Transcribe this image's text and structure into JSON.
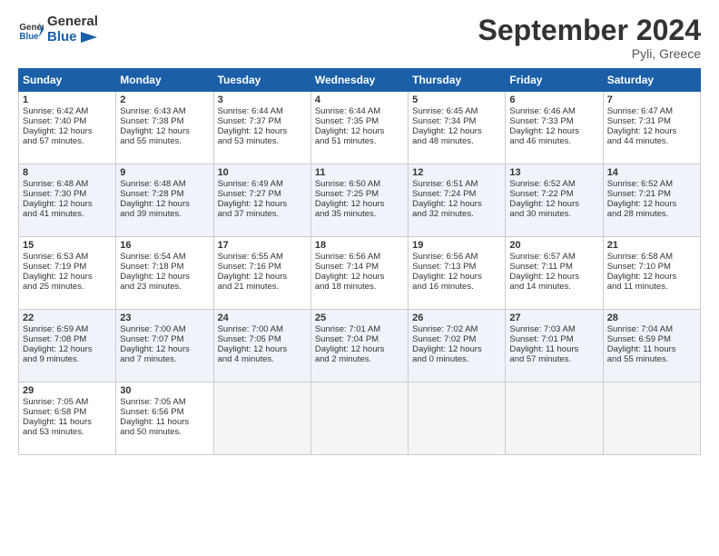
{
  "header": {
    "logo_line1": "General",
    "logo_line2": "Blue",
    "month": "September 2024",
    "location": "Pyli, Greece"
  },
  "weekdays": [
    "Sunday",
    "Monday",
    "Tuesday",
    "Wednesday",
    "Thursday",
    "Friday",
    "Saturday"
  ],
  "weeks": [
    [
      {
        "day": "1",
        "sunrise": "6:42 AM",
        "sunset": "7:40 PM",
        "daylight": "12 hours and 57 minutes."
      },
      {
        "day": "2",
        "sunrise": "6:43 AM",
        "sunset": "7:38 PM",
        "daylight": "12 hours and 55 minutes."
      },
      {
        "day": "3",
        "sunrise": "6:44 AM",
        "sunset": "7:37 PM",
        "daylight": "12 hours and 53 minutes."
      },
      {
        "day": "4",
        "sunrise": "6:44 AM",
        "sunset": "7:35 PM",
        "daylight": "12 hours and 51 minutes."
      },
      {
        "day": "5",
        "sunrise": "6:45 AM",
        "sunset": "7:34 PM",
        "daylight": "12 hours and 48 minutes."
      },
      {
        "day": "6",
        "sunrise": "6:46 AM",
        "sunset": "7:33 PM",
        "daylight": "12 hours and 46 minutes."
      },
      {
        "day": "7",
        "sunrise": "6:47 AM",
        "sunset": "7:31 PM",
        "daylight": "12 hours and 44 minutes."
      }
    ],
    [
      {
        "day": "8",
        "sunrise": "6:48 AM",
        "sunset": "7:30 PM",
        "daylight": "12 hours and 41 minutes."
      },
      {
        "day": "9",
        "sunrise": "6:48 AM",
        "sunset": "7:28 PM",
        "daylight": "12 hours and 39 minutes."
      },
      {
        "day": "10",
        "sunrise": "6:49 AM",
        "sunset": "7:27 PM",
        "daylight": "12 hours and 37 minutes."
      },
      {
        "day": "11",
        "sunrise": "6:50 AM",
        "sunset": "7:25 PM",
        "daylight": "12 hours and 35 minutes."
      },
      {
        "day": "12",
        "sunrise": "6:51 AM",
        "sunset": "7:24 PM",
        "daylight": "12 hours and 32 minutes."
      },
      {
        "day": "13",
        "sunrise": "6:52 AM",
        "sunset": "7:22 PM",
        "daylight": "12 hours and 30 minutes."
      },
      {
        "day": "14",
        "sunrise": "6:52 AM",
        "sunset": "7:21 PM",
        "daylight": "12 hours and 28 minutes."
      }
    ],
    [
      {
        "day": "15",
        "sunrise": "6:53 AM",
        "sunset": "7:19 PM",
        "daylight": "12 hours and 25 minutes."
      },
      {
        "day": "16",
        "sunrise": "6:54 AM",
        "sunset": "7:18 PM",
        "daylight": "12 hours and 23 minutes."
      },
      {
        "day": "17",
        "sunrise": "6:55 AM",
        "sunset": "7:16 PM",
        "daylight": "12 hours and 21 minutes."
      },
      {
        "day": "18",
        "sunrise": "6:56 AM",
        "sunset": "7:14 PM",
        "daylight": "12 hours and 18 minutes."
      },
      {
        "day": "19",
        "sunrise": "6:56 AM",
        "sunset": "7:13 PM",
        "daylight": "12 hours and 16 minutes."
      },
      {
        "day": "20",
        "sunrise": "6:57 AM",
        "sunset": "7:11 PM",
        "daylight": "12 hours and 14 minutes."
      },
      {
        "day": "21",
        "sunrise": "6:58 AM",
        "sunset": "7:10 PM",
        "daylight": "12 hours and 11 minutes."
      }
    ],
    [
      {
        "day": "22",
        "sunrise": "6:59 AM",
        "sunset": "7:08 PM",
        "daylight": "12 hours and 9 minutes."
      },
      {
        "day": "23",
        "sunrise": "7:00 AM",
        "sunset": "7:07 PM",
        "daylight": "12 hours and 7 minutes."
      },
      {
        "day": "24",
        "sunrise": "7:00 AM",
        "sunset": "7:05 PM",
        "daylight": "12 hours and 4 minutes."
      },
      {
        "day": "25",
        "sunrise": "7:01 AM",
        "sunset": "7:04 PM",
        "daylight": "12 hours and 2 minutes."
      },
      {
        "day": "26",
        "sunrise": "7:02 AM",
        "sunset": "7:02 PM",
        "daylight": "12 hours and 0 minutes."
      },
      {
        "day": "27",
        "sunrise": "7:03 AM",
        "sunset": "7:01 PM",
        "daylight": "11 hours and 57 minutes."
      },
      {
        "day": "28",
        "sunrise": "7:04 AM",
        "sunset": "6:59 PM",
        "daylight": "11 hours and 55 minutes."
      }
    ],
    [
      {
        "day": "29",
        "sunrise": "7:05 AM",
        "sunset": "6:58 PM",
        "daylight": "11 hours and 53 minutes."
      },
      {
        "day": "30",
        "sunrise": "7:05 AM",
        "sunset": "6:56 PM",
        "daylight": "11 hours and 50 minutes."
      },
      null,
      null,
      null,
      null,
      null
    ]
  ]
}
